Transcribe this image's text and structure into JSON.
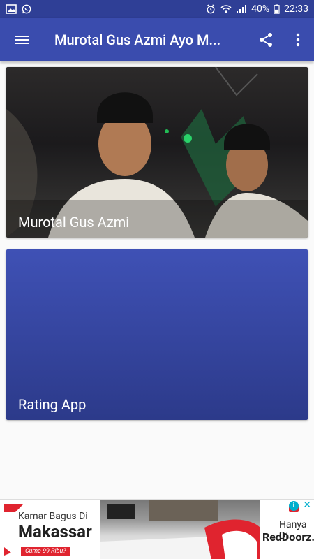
{
  "status_bar": {
    "battery": "40%",
    "time": "22:33"
  },
  "app_bar": {
    "title": "Murotal Gus Azmi Ayo M..."
  },
  "cards": [
    {
      "label": "Murotal Gus Azmi"
    },
    {
      "label": "Rating App"
    }
  ],
  "ad": {
    "line1": "Kamar Bagus Di",
    "line2": "Makassar",
    "tag": "Cuma 99 Ribu?",
    "right1": "Hanya Di",
    "right2": "RedDoorz.",
    "info": "i",
    "close": "✕"
  },
  "colors": {
    "status_bar": "#2f3f96",
    "app_bar": "#3a4cae",
    "card_blue": "#3f51b5"
  }
}
